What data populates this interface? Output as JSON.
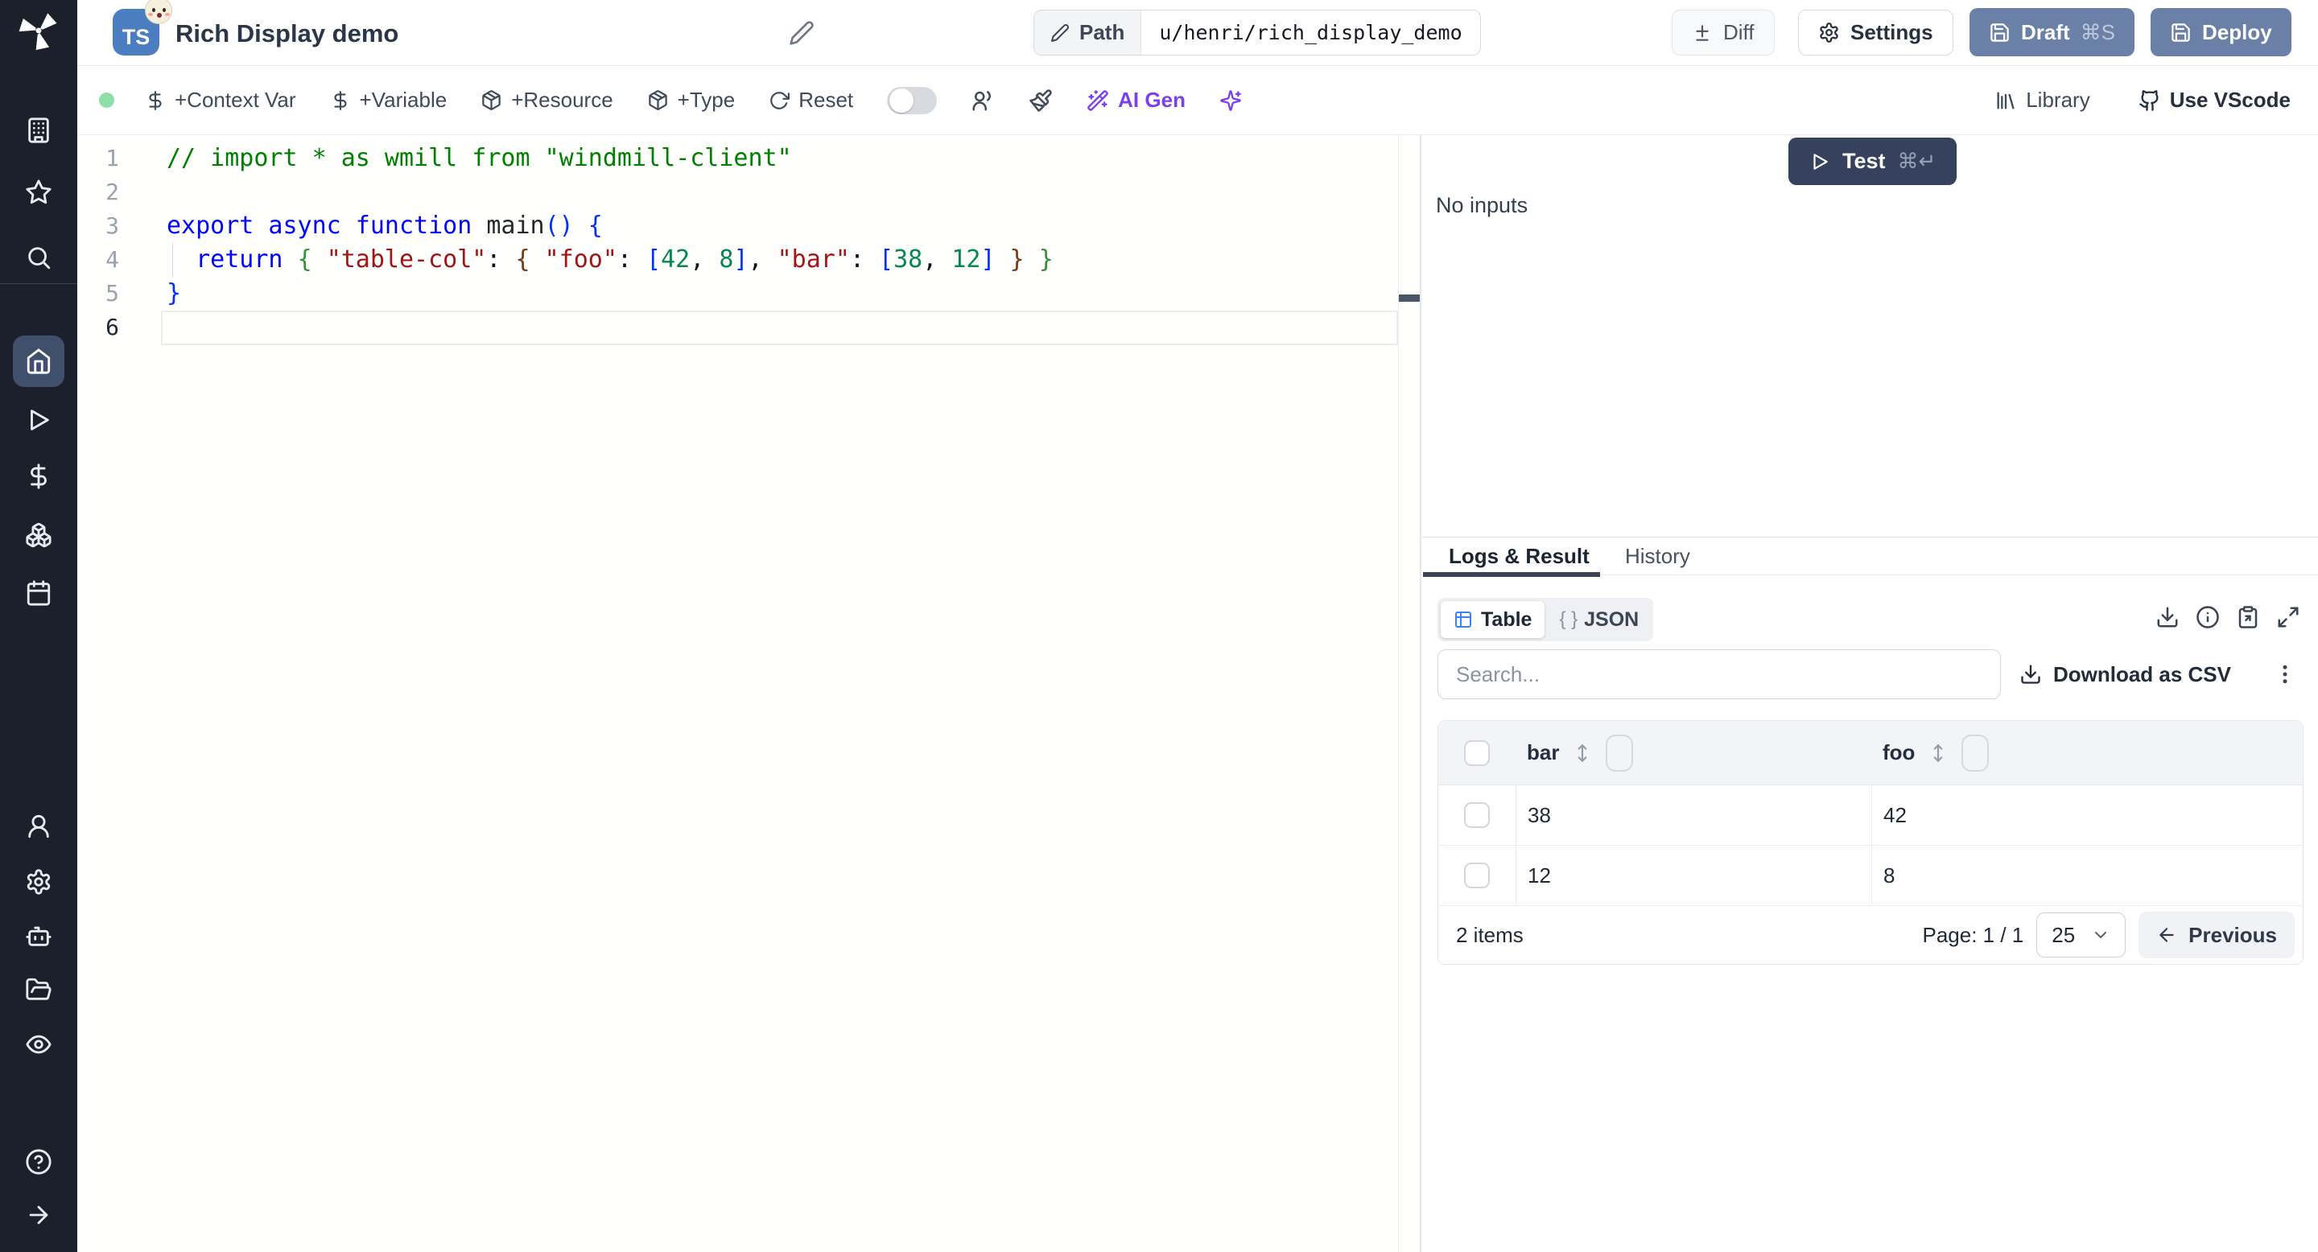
{
  "header": {
    "lang_badge": "TS",
    "title": "Rich Display demo",
    "path_label": "Path",
    "path_value": "u/henri/rich_display_demo",
    "diff_label": "Diff",
    "settings_label": "Settings",
    "draft_label": "Draft",
    "draft_shortcut": "⌘S",
    "deploy_label": "Deploy"
  },
  "toolbar": {
    "context_var_label": "+Context Var",
    "variable_label": "+Variable",
    "resource_label": "+Resource",
    "type_label": "+Type",
    "reset_label": "Reset",
    "ai_gen_label": "AI Gen",
    "library_label": "Library",
    "vscode_label": "Use VScode"
  },
  "editor": {
    "active_line": 6,
    "line_numbers": [
      "1",
      "2",
      "3",
      "4",
      "5",
      "6"
    ],
    "lines": [
      {
        "tokens": [
          {
            "s": "comment",
            "text": "// import * as wmill from \"windmill-client\""
          }
        ]
      },
      {
        "tokens": []
      },
      {
        "tokens": [
          {
            "s": "keyword",
            "text": "export async function "
          },
          {
            "s": "func",
            "text": "main"
          },
          {
            "s": "b1",
            "text": "() {"
          }
        ]
      },
      {
        "tokens": [
          {
            "s": "plain",
            "text": "  "
          },
          {
            "s": "keyword",
            "text": "return"
          },
          {
            "s": "plain",
            "text": " "
          },
          {
            "s": "b2",
            "text": "{"
          },
          {
            "s": "plain",
            "text": " "
          },
          {
            "s": "string",
            "text": "\"table-col\""
          },
          {
            "s": "plain",
            "text": ": "
          },
          {
            "s": "b3",
            "text": "{"
          },
          {
            "s": "plain",
            "text": " "
          },
          {
            "s": "string",
            "text": "\"foo\""
          },
          {
            "s": "plain",
            "text": ": "
          },
          {
            "s": "b1",
            "text": "["
          },
          {
            "s": "number",
            "text": "42"
          },
          {
            "s": "plain",
            "text": ", "
          },
          {
            "s": "number",
            "text": "8"
          },
          {
            "s": "b1",
            "text": "]"
          },
          {
            "s": "plain",
            "text": ", "
          },
          {
            "s": "string",
            "text": "\"bar\""
          },
          {
            "s": "plain",
            "text": ": "
          },
          {
            "s": "b1",
            "text": "["
          },
          {
            "s": "number",
            "text": "38"
          },
          {
            "s": "plain",
            "text": ", "
          },
          {
            "s": "number",
            "text": "12"
          },
          {
            "s": "b1",
            "text": "]"
          },
          {
            "s": "plain",
            "text": " "
          },
          {
            "s": "b3",
            "text": "}"
          },
          {
            "s": "plain",
            "text": " "
          },
          {
            "s": "b2",
            "text": "}"
          }
        ]
      },
      {
        "tokens": [
          {
            "s": "b1",
            "text": "}"
          }
        ]
      },
      {
        "tokens": []
      }
    ]
  },
  "run_panel": {
    "test_label": "Test",
    "test_shortcut": "⌘↵",
    "no_inputs_text": "No inputs"
  },
  "result_panel": {
    "tabs": [
      {
        "label": "Logs & Result"
      },
      {
        "label": "History"
      }
    ],
    "view_toggle": {
      "table_label": "Table",
      "json_glyph": "{ }",
      "json_label": "JSON"
    },
    "search_placeholder": "Search...",
    "download_csv_label": "Download as CSV",
    "table": {
      "columns": [
        {
          "name": "bar"
        },
        {
          "name": "foo"
        }
      ],
      "rows": [
        {
          "bar": "38",
          "foo": "42"
        },
        {
          "bar": "12",
          "foo": "8"
        }
      ],
      "footer": {
        "items_text": "2 items",
        "page_text": "Page: 1 / 1",
        "page_size": "25",
        "previous_label": "Previous"
      }
    }
  },
  "colors": {
    "sidebar_bg": "#1b202b",
    "ts_badge_blue": "#4a7ec1",
    "slate_button": "#6b80a6",
    "test_button_navy": "#36415e",
    "ai_purple": "#7b40ec",
    "status_green": "#8ce0a8",
    "table_icon_blue": "#3b82f6"
  }
}
